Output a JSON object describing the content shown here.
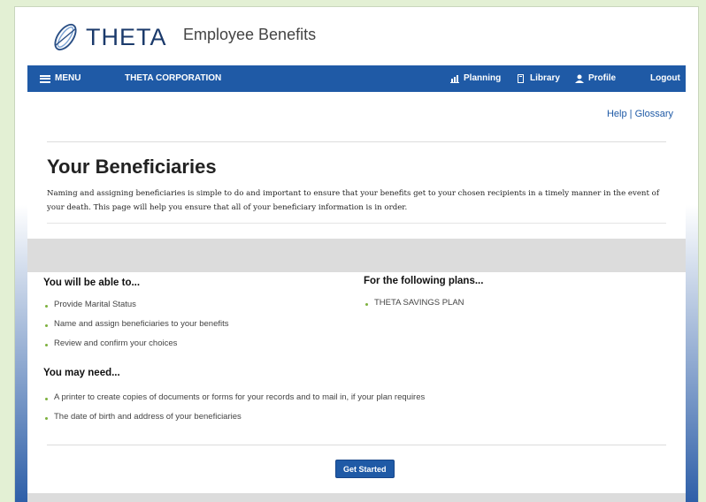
{
  "header": {
    "logo_text": "THETA",
    "app_title": "Employee Benefits"
  },
  "nav": {
    "menu_label": "MENU",
    "company_label": "THETA CORPORATION",
    "planning_label": "Planning",
    "library_label": "Library",
    "profile_label": "Profile",
    "logout_label": "Logout",
    "icons": [
      "menu-icon",
      "bar-chart-icon",
      "book-icon",
      "person-icon"
    ]
  },
  "help": {
    "help_label": "Help",
    "separator": " | ",
    "glossary_label": "Glossary"
  },
  "page": {
    "title": "Your Beneficiaries",
    "intro": "Naming and assigning beneficiaries is simple to do and important to ensure that your benefits get to your chosen recipients in a timely manner in the event of your death. This page will help you ensure that all of your beneficiary information is in order."
  },
  "able": {
    "title": "You will be able to...",
    "items": [
      "Provide Marital Status",
      "Name and assign beneficiaries to your benefits",
      "Review and confirm your choices"
    ]
  },
  "plans": {
    "title": "For the following plans...",
    "items": [
      "THETA SAVINGS PLAN"
    ]
  },
  "need": {
    "title": "You may need...",
    "items": [
      "A printer to create copies of documents or forms for your records and to mail in, if your plan requires",
      "The date of birth and address of your beneficiaries"
    ]
  },
  "actions": {
    "get_started_label": "Get Started"
  },
  "colors": {
    "nav_blue": "#1f5aa6",
    "page_green": "#e3f0d4",
    "bullet_green": "#7db13e"
  }
}
